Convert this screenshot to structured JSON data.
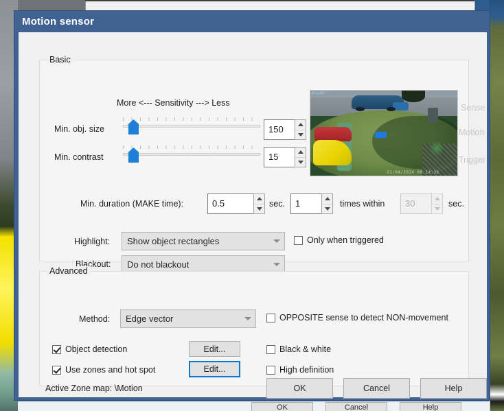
{
  "window": {
    "title": "Motion sensor"
  },
  "background": {
    "behind_buttons": [
      "OK",
      "Cancel",
      "Help"
    ]
  },
  "basic": {
    "legend": "Basic",
    "sensitivity_scale": "More <--- Sensitivity ---> Less",
    "min_obj_size": {
      "label": "Min. obj. size",
      "value": "150",
      "thumb_percent": 4
    },
    "min_contrast": {
      "label": "Min. contrast",
      "value": "15",
      "thumb_percent": 4
    },
    "duration": {
      "label": "Min. duration (MAKE time):",
      "value": "0.5",
      "unit": "sec.",
      "times_value": "1",
      "times_label": "times within",
      "within_value": "30",
      "within_unit": "sec."
    },
    "highlight": {
      "label": "Highlight:",
      "value": "Show object rectangles"
    },
    "blackout": {
      "label": "Blackout:",
      "value": "Do not blackout"
    },
    "only_when_triggered": {
      "label": "Only when triggered",
      "checked": false
    }
  },
  "preview": {
    "timestamp": "21/04/2024  09:14:36",
    "logo": "B-Cam",
    "indicators": [
      {
        "label": "Sense"
      },
      {
        "label": "Motion"
      },
      {
        "label": "Trigger"
      }
    ]
  },
  "advanced": {
    "legend": "Advanced",
    "method": {
      "label": "Method:",
      "value": "Edge vector"
    },
    "opposite_sense": {
      "label": "OPPOSITE sense to detect NON-movement",
      "checked": false
    },
    "object_detection": {
      "label": "Object detection",
      "checked": true,
      "edit_label": "Edit..."
    },
    "use_zones": {
      "label": "Use zones and hot spot",
      "checked": true,
      "edit_label": "Edit..."
    },
    "black_white": {
      "label": "Black & white",
      "checked": false
    },
    "high_definition": {
      "label": "High definition",
      "checked": false
    }
  },
  "footer": {
    "active_zone_map": "Active Zone map:  \\Motion",
    "ok": "OK",
    "cancel": "Cancel",
    "help": "Help"
  },
  "colors": {
    "titlebar": "#3f6293",
    "accent": "#1d7fd6",
    "focus": "#0078d7",
    "dialog_bg": "#f0f0f0",
    "disabled_text": "#c8c8c8"
  }
}
